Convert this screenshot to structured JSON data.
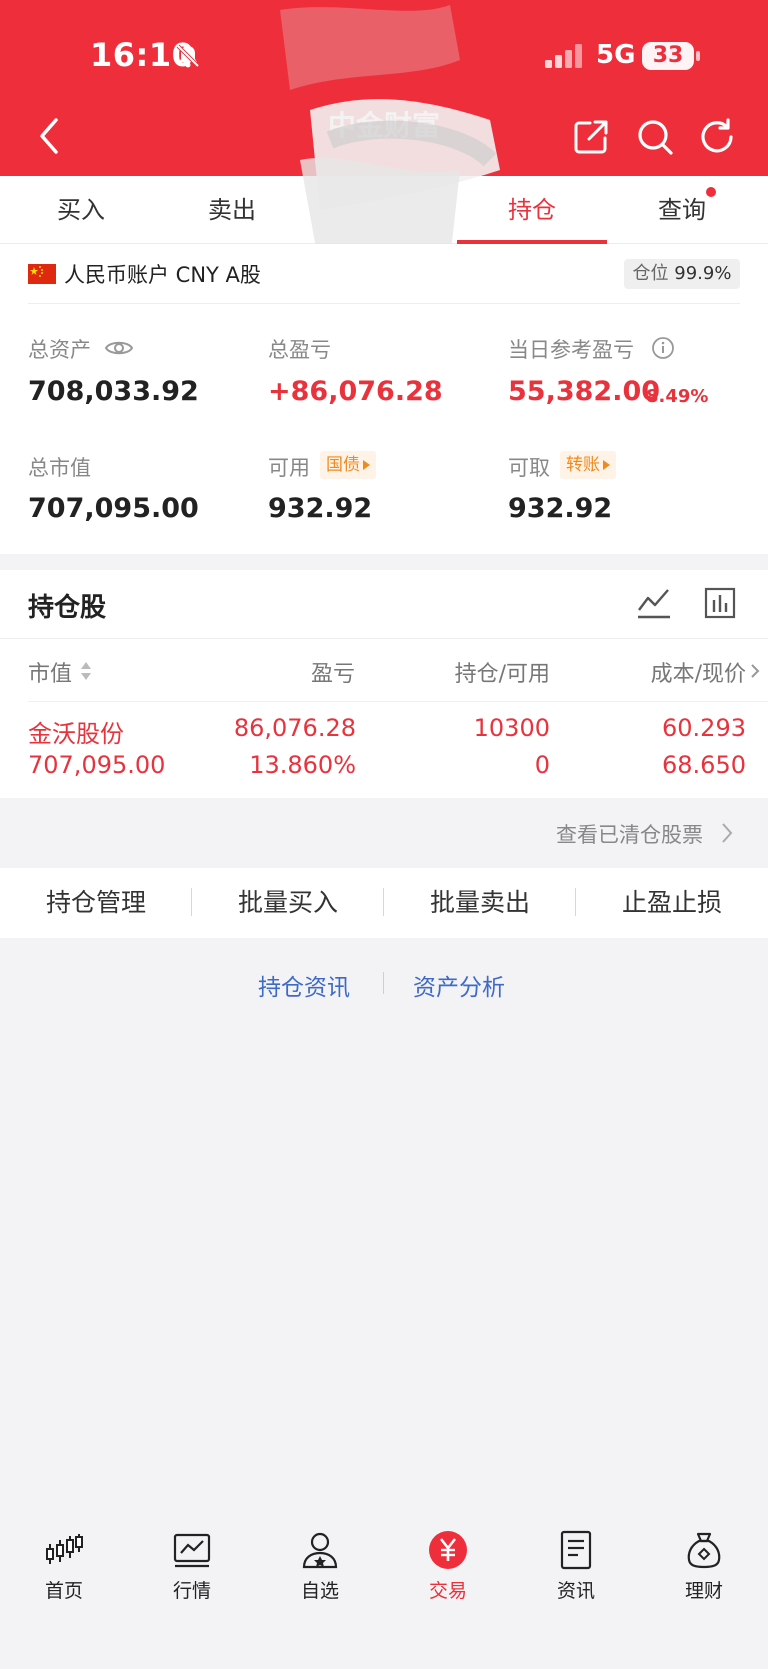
{
  "status_bar": {
    "time": "16:10",
    "network": "5G",
    "battery": "33"
  },
  "header": {
    "title": "中金财富"
  },
  "tabs": [
    {
      "label": "买入"
    },
    {
      "label": "卖出"
    },
    {
      "label": ""
    },
    {
      "label": "持仓"
    },
    {
      "label": "查询"
    }
  ],
  "account": {
    "label": "人民币账户 CNY A股",
    "position_label": "仓位",
    "position_value": "99.9%",
    "total_assets_label": "总资产",
    "total_assets": "708,033.92",
    "total_pnl_label": "总盈亏",
    "total_pnl": "+86,076.28",
    "daily_pnl_label": "当日参考盈亏",
    "daily_pnl": "55,382.00",
    "daily_pnl_pct": "8.49%",
    "market_value_label": "总市值",
    "market_value": "707,095.00",
    "available_label": "可用",
    "available_tag": "国债",
    "available": "932.92",
    "withdrawable_label": "可取",
    "withdrawable_tag": "转账",
    "withdrawable": "932.92"
  },
  "holdings": {
    "title": "持仓股",
    "columns": [
      "市值",
      "盈亏",
      "持仓/可用",
      "成本/现价"
    ],
    "rows": [
      {
        "name": "金沃股份",
        "market_value": "707,095.00",
        "pnl": "86,076.28",
        "pnl_pct": "13.860%",
        "position": "10300",
        "available": "0",
        "cost": "60.293",
        "price": "68.650"
      }
    ],
    "cleared_link": "查看已清仓股票"
  },
  "actions": [
    "持仓管理",
    "批量买入",
    "批量卖出",
    "止盈止损"
  ],
  "links": [
    "持仓资讯",
    "资产分析"
  ],
  "bottom_nav": [
    {
      "label": "首页",
      "icon": "candlestick-icon"
    },
    {
      "label": "行情",
      "icon": "market-chart-icon"
    },
    {
      "label": "自选",
      "icon": "user-star-icon"
    },
    {
      "label": "交易",
      "icon": "yuan-icon",
      "active": true
    },
    {
      "label": "资讯",
      "icon": "news-icon"
    },
    {
      "label": "理财",
      "icon": "money-bag-icon"
    }
  ],
  "colors": {
    "brand_red": "#ee2f3b",
    "profit_red": "#e8333d",
    "link_blue": "#3e6ac6",
    "tag_orange": "#f08a1d"
  }
}
